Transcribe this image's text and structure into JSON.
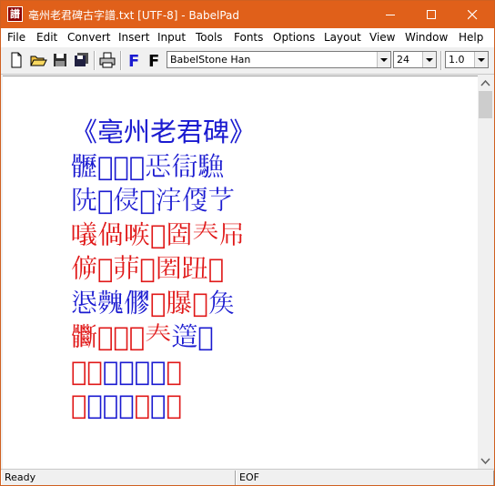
{
  "window": {
    "title": "亳州老君碑古字譜.txt [UTF-8] - BabelPad",
    "app_icon_glyph": "譜",
    "titlebar_color": "#e0601a"
  },
  "menu": [
    "File",
    "Edit",
    "Convert",
    "Insert",
    "Input",
    "Tools",
    "Fonts",
    "Options",
    "Layout",
    "View",
    "Window",
    "Help"
  ],
  "toolbar": {
    "font_name": "BabelStone Han",
    "font_size": "24",
    "line_spacing": "1.0"
  },
  "colors": {
    "blue_text": "#1a1ad0",
    "red_text": "#e01818"
  },
  "document": {
    "lines": [
      {
        "segments": [
          {
            "text": "《亳州老君碑》",
            "color": "blue"
          }
        ]
      },
      {
        "segments": [
          {
            "text": "𩪸𨈐𡧑𢪭𢘫𧗳𩥭",
            "color": "blue"
          }
        ]
      },
      {
        "segments": [
          {
            "text": "𨸪𠆀𠊸𨪆𣳿𠊳𦫼",
            "color": "blue"
          }
        ]
      },
      {
        "segments": [
          {
            "text": "𠿿𠊰𠹋𥘩𡇣𡗗𡰯",
            "color": "red"
          }
        ]
      },
      {
        "segments": [
          {
            "text": "𠊴𠑕𦯆𣶭𡈉𧿔𢊞",
            "color": "red"
          }
        ]
      },
      {
        "segments": [
          {
            "text": "𢛣𩴲𠐋",
            "color": "blue"
          },
          {
            "text": "𥋬𦢊𥜮",
            "color": "red"
          },
          {
            "text": "𡘓",
            "color": "blue"
          }
        ]
      },
      {
        "segments": [
          {
            "text": "𩪽𢣫𡞶𣺕𡗗",
            "color": "red"
          },
          {
            "text": "𨗡𠥏",
            "color": "blue"
          }
        ]
      },
      {
        "segments": [
          {
            "text": "𡎥𠋗",
            "color": "red"
          },
          {
            "text": "𠫶𠫵𥆞𦝀",
            "color": "blue"
          },
          {
            "text": "𩠰",
            "color": "red"
          }
        ]
      },
      {
        "segments": [
          {
            "text": "𡘦",
            "color": "red"
          },
          {
            "text": "𨷽𧦧𠪠",
            "color": "blue"
          },
          {
            "text": "𡤾",
            "color": "red"
          },
          {
            "text": "𨝹",
            "color": "blue"
          },
          {
            "text": "𣩖",
            "color": "red"
          }
        ]
      }
    ]
  },
  "status": {
    "left": "Ready",
    "middle": "EOF"
  }
}
